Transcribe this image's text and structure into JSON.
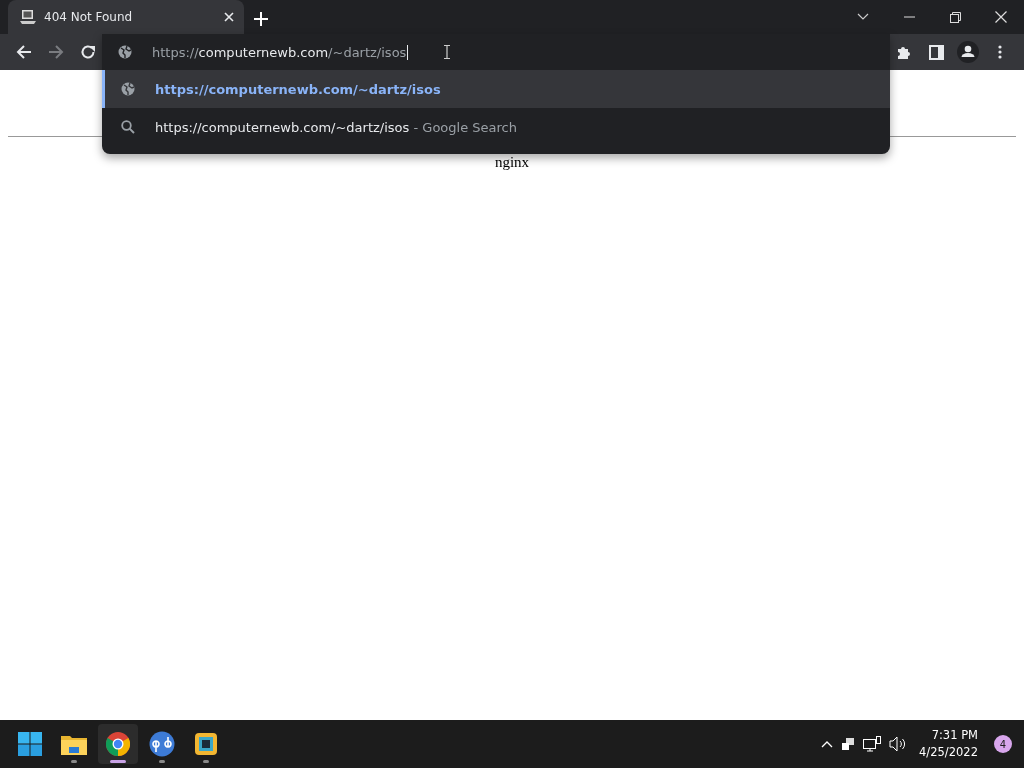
{
  "tabs": [
    {
      "title": "404 Not Found",
      "selected": true
    }
  ],
  "omnibox": {
    "scheme": "https://",
    "host": "computernewb.com",
    "path": "/~dartz/isos"
  },
  "suggestions": [
    {
      "kind": "url",
      "text": "https://computernewb.com/~dartz/isos",
      "selected": true
    },
    {
      "kind": "search",
      "text": "https://computernewb.com/~dartz/isos",
      "suffix": "- Google Search",
      "selected": false
    }
  ],
  "page": {
    "footer": "nginx"
  },
  "taskbar": {
    "apps": [
      {
        "kind": "start",
        "running": false,
        "selected": false
      },
      {
        "kind": "files",
        "running": true,
        "selected": false
      },
      {
        "kind": "chrome",
        "running": true,
        "selected": true
      },
      {
        "kind": "qbittorrent",
        "running": true,
        "selected": false
      },
      {
        "kind": "vm",
        "running": true,
        "selected": false
      }
    ],
    "time": "7:31 PM",
    "date": "4/25/2022",
    "notifications": "4"
  }
}
